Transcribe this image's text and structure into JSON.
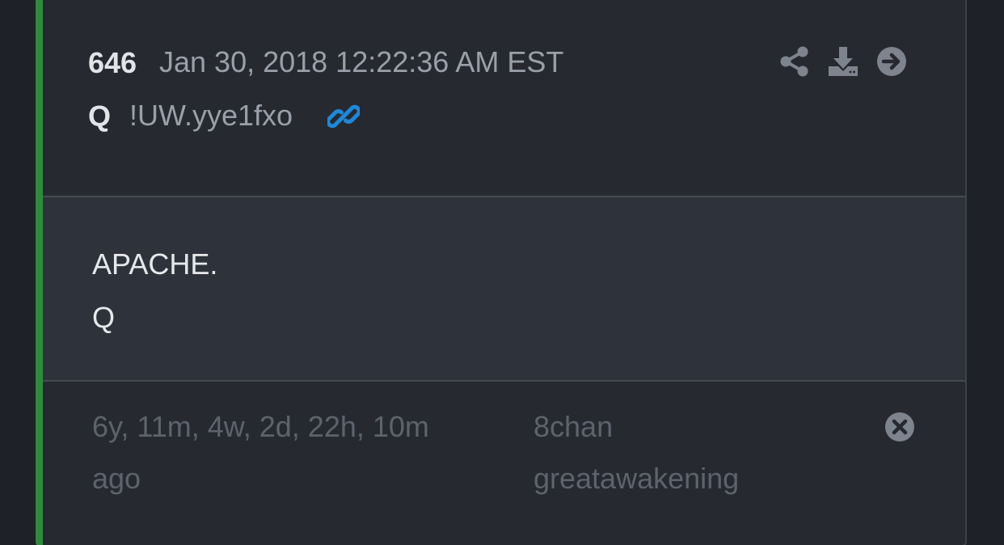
{
  "post": {
    "number": "646",
    "date": "Jan 30, 2018 12:22:36 AM EST",
    "author": "Q",
    "tripcode": "!UW.yye1fxo",
    "body_lines": [
      "APACHE.",
      "Q"
    ],
    "age_line1": "6y, 11m, 4w, 2d, 22h, 10m",
    "age_line2": "ago",
    "source_line1": "8chan",
    "source_line2": "greatawakening"
  },
  "icons": {
    "link": "link-icon",
    "share": "share-icon",
    "download": "download-icon",
    "navigate": "arrow-right-circle-icon",
    "close": "close-circle-icon"
  },
  "colors": {
    "accent_border": "#2e8b3c",
    "link_icon": "#1e88d8",
    "background": "#1e2127",
    "card": "#262930",
    "body_panel": "#2e333b"
  }
}
